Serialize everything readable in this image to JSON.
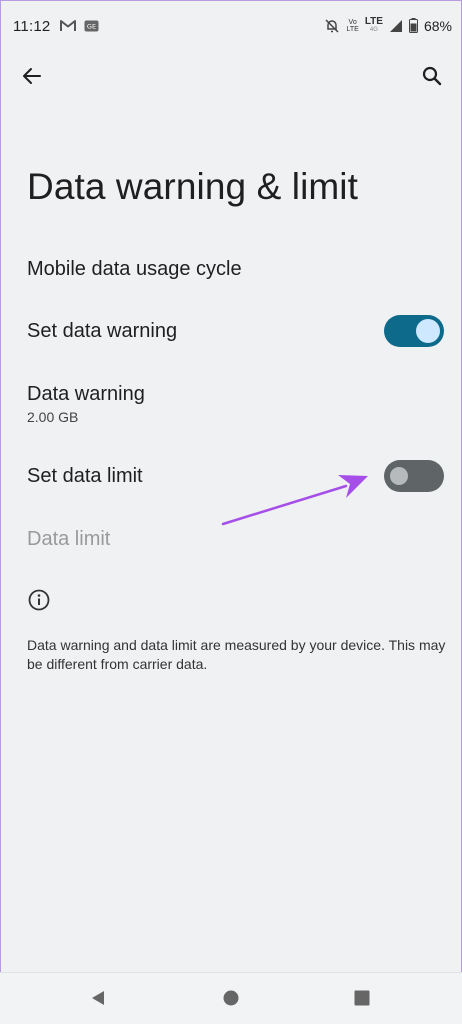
{
  "status_bar": {
    "time": "11:12",
    "volte_top": "Vo",
    "volte_bottom": "LTE",
    "lte": "LTE",
    "lte_sub": "4G",
    "battery": "68%"
  },
  "header": {
    "title": "Data warning & limit"
  },
  "settings": {
    "usage_cycle": "Mobile data usage cycle",
    "set_warning": "Set data warning",
    "warning_title": "Data warning",
    "warning_value": "2.00 GB",
    "set_limit": "Set data limit",
    "limit_title": "Data limit"
  },
  "toggles": {
    "set_warning_on": true,
    "set_limit_on": false
  },
  "footer": {
    "info_text": "Data warning and data limit are measured by your device. This may be different from carrier data."
  },
  "colors": {
    "toggle_on": "#0e6a8a",
    "toggle_off": "#5f6466",
    "annotation_arrow": "#a64ee8",
    "background": "#eff1f3"
  },
  "icons": {
    "back": "arrow-back-icon",
    "search": "search-icon",
    "info": "info-icon",
    "gmail": "gmail-icon",
    "notification": "notification-badge-icon",
    "mute": "bell-off-icon",
    "signal": "signal-icon",
    "battery": "battery-icon"
  }
}
